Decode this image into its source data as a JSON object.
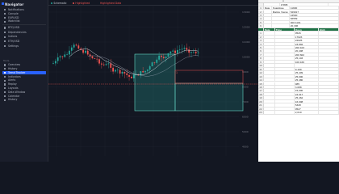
{
  "sidebar": {
    "title": "Navigator",
    "items": [
      {
        "label": "Notifications",
        "icon": "bell-icon"
      },
      {
        "label": "Console",
        "icon": "terminal-icon"
      },
      {
        "label": "EURUSD",
        "icon": "currency-icon"
      },
      {
        "label": "Watchlist",
        "icon": "list-icon"
      }
    ],
    "group1": [
      {
        "label": "BTC/USD",
        "icon": "bitcoin-icon"
      },
      {
        "label": "Dependencies",
        "icon": "link-icon"
      },
      {
        "label": "Indices",
        "icon": "chart-icon"
      },
      {
        "label": "ETH/USD",
        "icon": "ethereum-icon"
      },
      {
        "label": "Settings",
        "icon": "gear-icon"
      }
    ],
    "section_label": "Tools",
    "group2": [
      {
        "label": "Overview",
        "icon": "grid-icon",
        "active": false
      },
      {
        "label": "History",
        "icon": "clock-icon",
        "active": false
      },
      {
        "label": "Trend Tracker",
        "icon": "trend-icon",
        "active": true
      },
      {
        "label": "Indicators",
        "icon": "function-icon",
        "active": false
      },
      {
        "label": "Alerts",
        "icon": "alert-icon",
        "active": false
      },
      {
        "label": "Replay",
        "icon": "replay-icon",
        "active": false
      },
      {
        "label": "Layouts",
        "icon": "layout-icon",
        "active": false
      },
      {
        "label": "Data Window",
        "icon": "window-icon",
        "active": false
      },
      {
        "label": "Calendar",
        "icon": "calendar-icon",
        "active": false
      },
      {
        "label": "History",
        "icon": "history-icon",
        "active": false
      }
    ]
  },
  "chart": {
    "tabs": [
      {
        "label": "Schematic",
        "color": "#26a69a"
      },
      {
        "label": "Highlighted",
        "color": "#ef5350"
      },
      {
        "label": "Highlighted Data",
        "color": "#2962ff"
      }
    ],
    "price_labels": [
      "13000",
      "12000",
      "11000",
      "10000",
      "9000",
      "8000",
      "7000",
      "6000",
      "5000",
      "4000"
    ],
    "marker_label": "1",
    "colors": {
      "up": "#26a69a",
      "down": "#ef5350",
      "ma": "#d1d4dc",
      "ma2": "#b0b8c8",
      "zone": "#26a69a"
    }
  },
  "sheet": {
    "col_headers": [
      "",
      "A"
    ],
    "top_rows": [
      {
        "n": "",
        "cells": [
          "",
          "17805"
        ]
      },
      {
        "n": "1",
        "cells": [
          "Date",
          "Snaddose",
          "11900"
        ]
      },
      {
        "n": "2",
        "cells": [
          "",
          "Malgre Vieras",
          "529917"
        ]
      },
      {
        "n": "3",
        "cells": [
          "",
          "",
          "44500"
        ]
      },
      {
        "n": "4",
        "cells": [
          "",
          "",
          "66559"
        ]
      },
      {
        "n": "5",
        "cells": [
          "",
          "",
          "300 1101"
        ]
      },
      {
        "n": "6",
        "cells": [
          "",
          "",
          "20,306"
        ]
      }
    ],
    "header": [
      "Date",
      "Time",
      "Open",
      "High"
    ],
    "rows": [
      {
        "n": "1",
        "v": "9526"
      },
      {
        "n": "2",
        "v": "17023"
      },
      {
        "n": "3",
        "v": "22025"
      },
      {
        "n": "4",
        "v": "23,892"
      },
      {
        "n": "5",
        "v": "200 103"
      },
      {
        "n": "6",
        "v": "20,408"
      },
      {
        "n": "7",
        "v": "200 602"
      },
      {
        "n": "8",
        "v": "25,103"
      },
      {
        "n": "9",
        "v": "100,166"
      },
      {
        "n": "10",
        "v": ""
      },
      {
        "n": "11",
        "v": "9,109"
      },
      {
        "n": "12",
        "v": "25,409"
      },
      {
        "n": "13",
        "v": "25,000"
      },
      {
        "n": "14",
        "v": "25,480"
      },
      {
        "n": "15",
        "v": "985"
      },
      {
        "n": "16",
        "v": "3,088"
      },
      {
        "n": "17",
        "v": "15,000"
      },
      {
        "n": "18",
        "v": "24,017"
      },
      {
        "n": "19",
        "v": "25,462"
      },
      {
        "n": "20",
        "v": "16,008"
      },
      {
        "n": "21",
        "v": "5328"
      },
      {
        "n": "22",
        "v": "9527"
      },
      {
        "n": "23",
        "v": "2,010"
      }
    ]
  }
}
